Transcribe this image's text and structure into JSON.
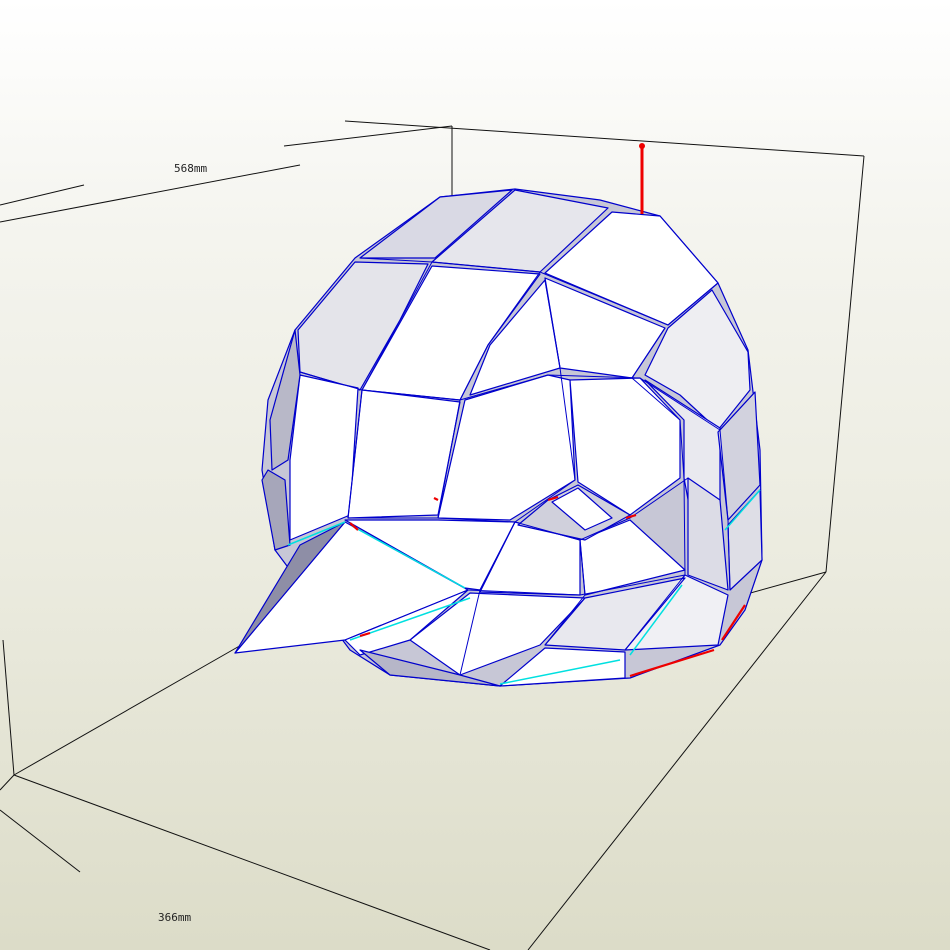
{
  "viewport": {
    "dimension_width": "568mm",
    "dimension_depth": "366mm"
  },
  "colors": {
    "background_top": "#ffffff",
    "background_bottom": "#dcdcc8",
    "edge_outline": "#0000cc",
    "valley_fold": "#00e0e0",
    "cut_edge": "#ee0000",
    "face_fill": "#ffffff",
    "face_shade": "#b8b8c8",
    "axis_marker": "#ee0000"
  }
}
